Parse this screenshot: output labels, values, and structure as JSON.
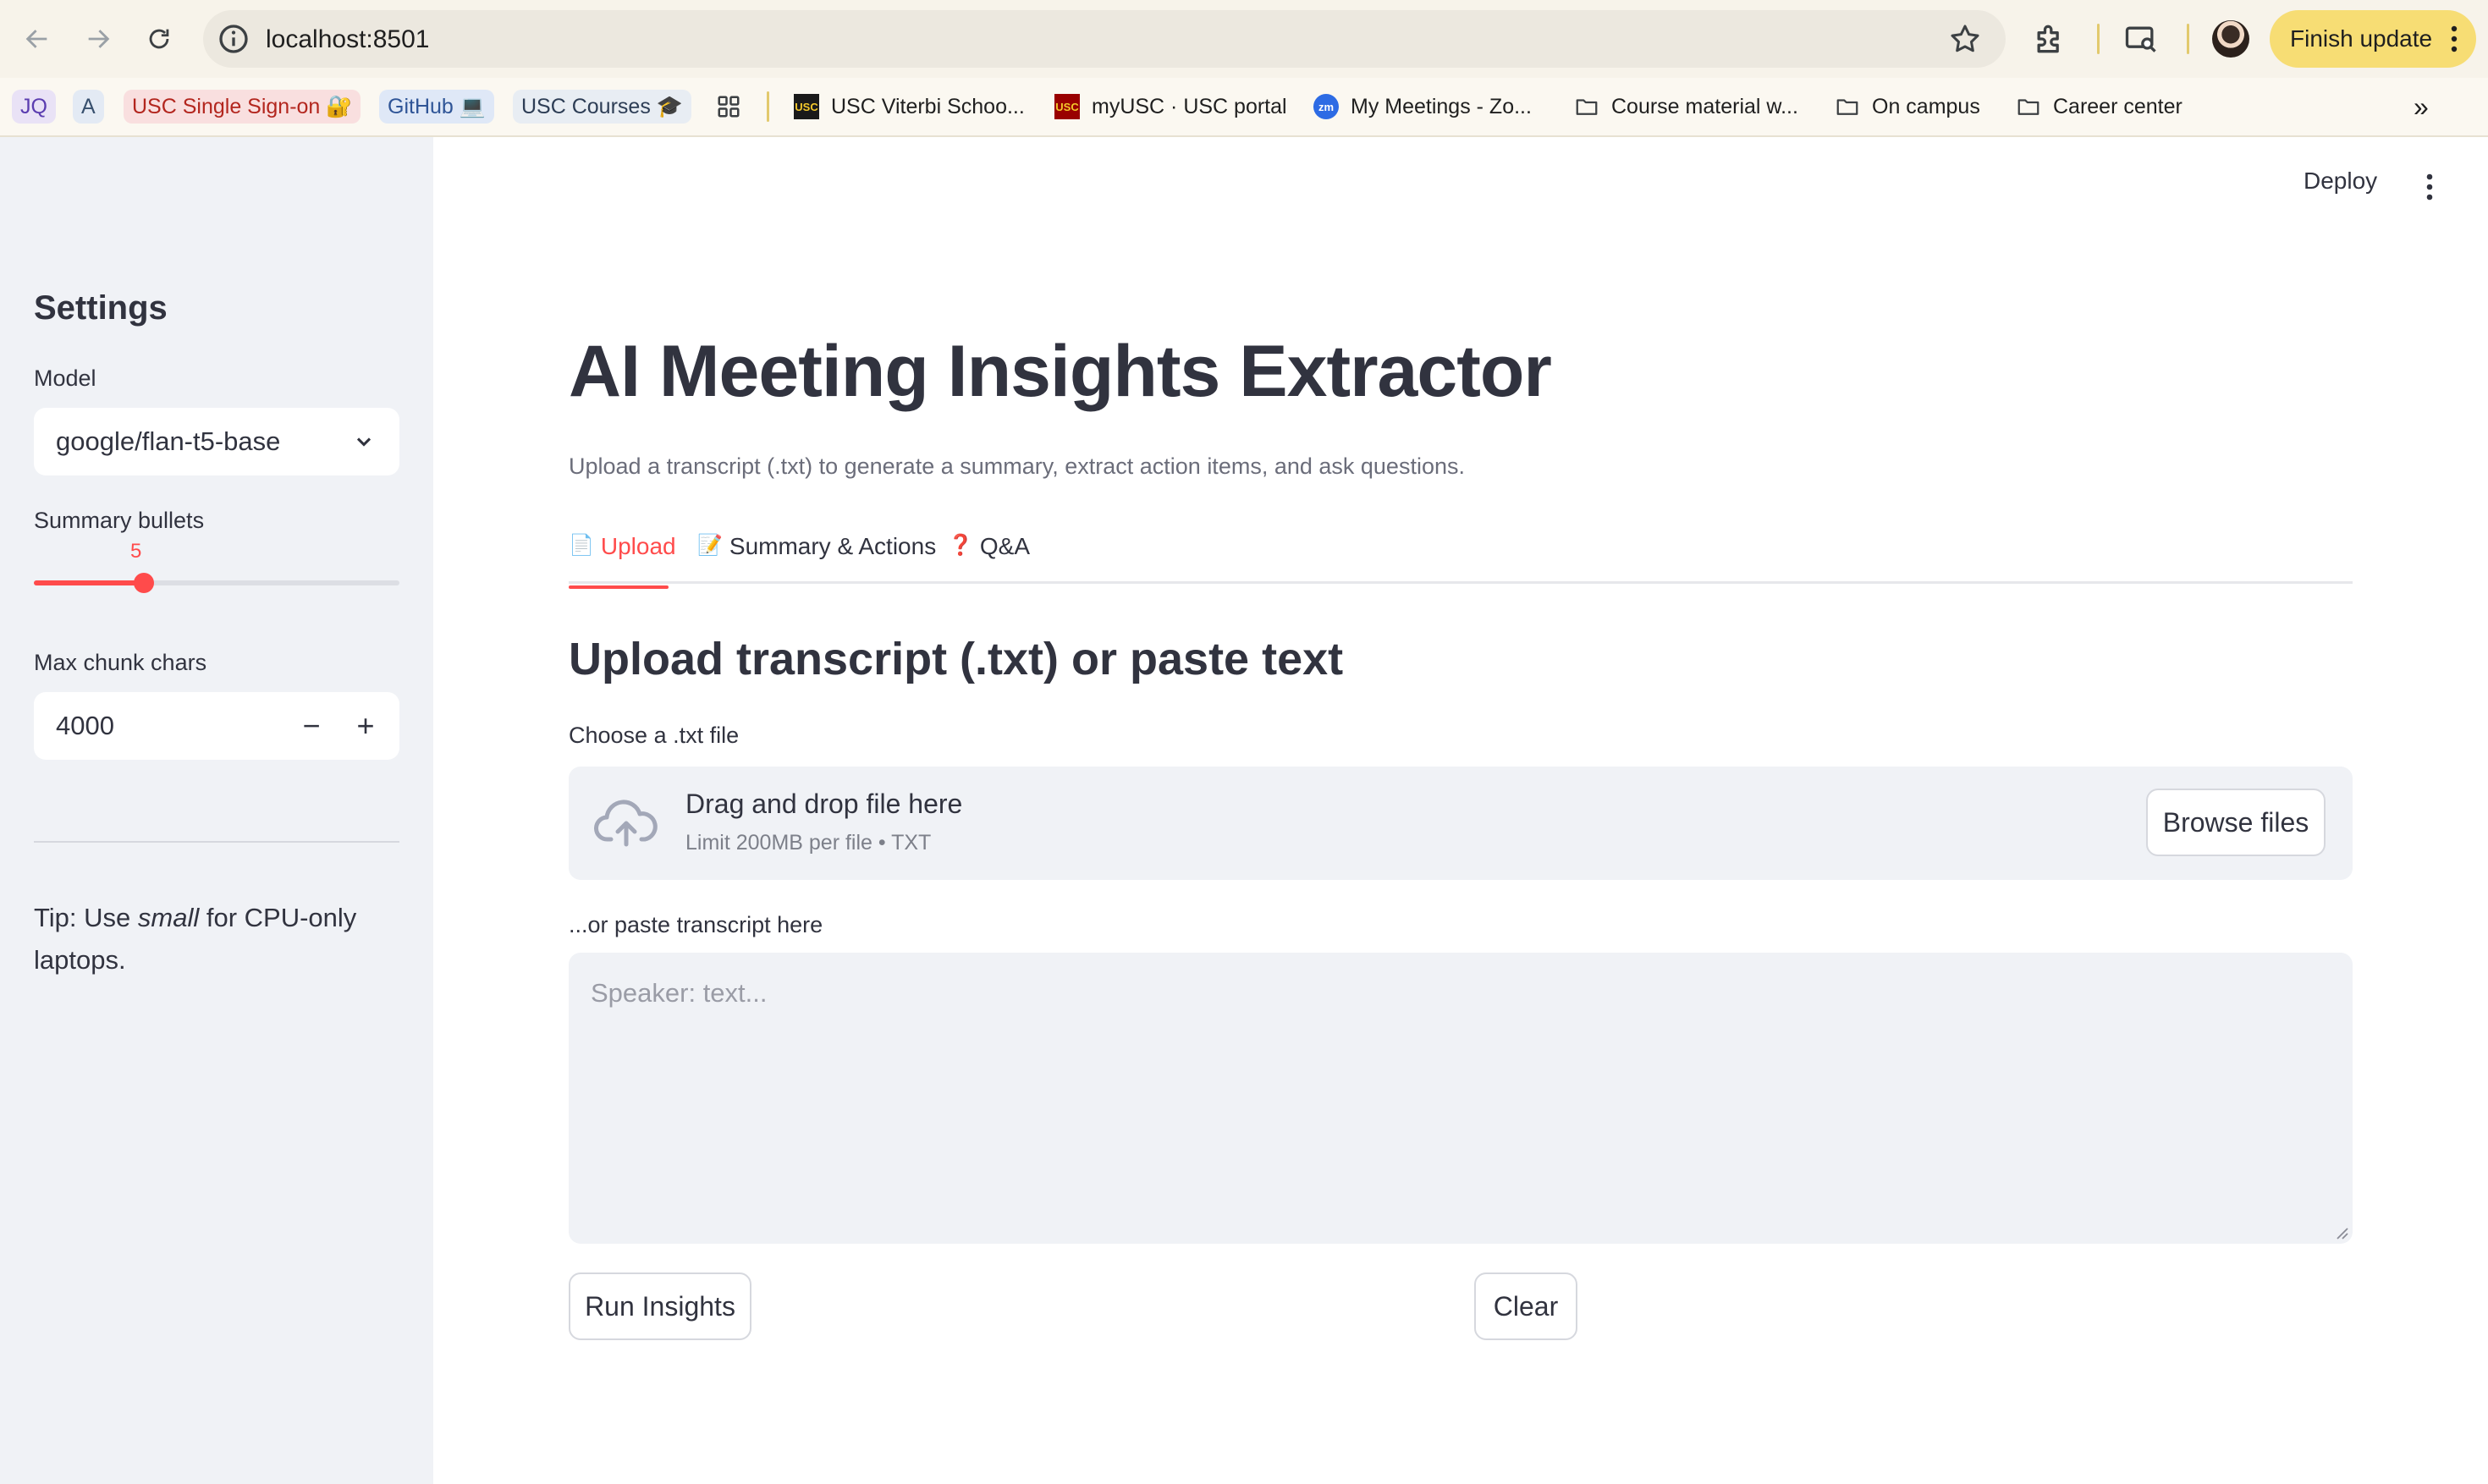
{
  "browser": {
    "url": "localhost:8501",
    "finish_update": "Finish update",
    "bookmarks": [
      {
        "label": "JQ"
      },
      {
        "label": "A"
      },
      {
        "label": "USC Single Sign-on 🔐"
      },
      {
        "label": "GitHub 💻"
      },
      {
        "label": "USC Courses 🎓"
      },
      {
        "label": "USC Viterbi Schoo..."
      },
      {
        "label": "myUSC · USC portal"
      },
      {
        "label": "My Meetings - Zo..."
      },
      {
        "label": "Course material w..."
      },
      {
        "label": "On campus"
      },
      {
        "label": "Career center"
      }
    ],
    "favicons": {
      "usc": "USC",
      "zoom": "zm"
    },
    "more_bookmarks": "»"
  },
  "sidebar": {
    "title": "Settings",
    "model_label": "Model",
    "model_value": "google/flan-t5-base",
    "bullets_label": "Summary bullets",
    "bullets_value": "5",
    "bullets_fraction": 0.3,
    "chunk_label": "Max chunk chars",
    "chunk_value": "4000",
    "minus": "−",
    "plus": "+",
    "tip_prefix": "Tip: Use ",
    "tip_em": "small",
    "tip_suffix": " for CPU-only laptops."
  },
  "header": {
    "deploy": "Deploy"
  },
  "main": {
    "title": "AI Meeting Insights Extractor",
    "subtitle": "Upload a transcript (.txt) to generate a summary, extract action items, and ask questions.",
    "tabs": [
      {
        "icon": "📄",
        "label": "Upload"
      },
      {
        "icon": "📝",
        "label": "Summary & Actions"
      },
      {
        "icon": "❓",
        "label": "Q&A"
      }
    ],
    "section_title": "Upload transcript (.txt) or paste text",
    "file_label": "Choose a .txt file",
    "dropzone_title": "Drag and drop file here",
    "dropzone_sub": "Limit 200MB per file • TXT",
    "browse": "Browse files",
    "paste_label": "...or paste transcript here",
    "paste_placeholder": "Speaker: text...",
    "run": "Run Insights",
    "clear": "Clear"
  },
  "colors": {
    "accent": "#ff4b4b",
    "sidebar_bg": "#f0f2f6",
    "finish_update_bg": "#f7dd74"
  }
}
